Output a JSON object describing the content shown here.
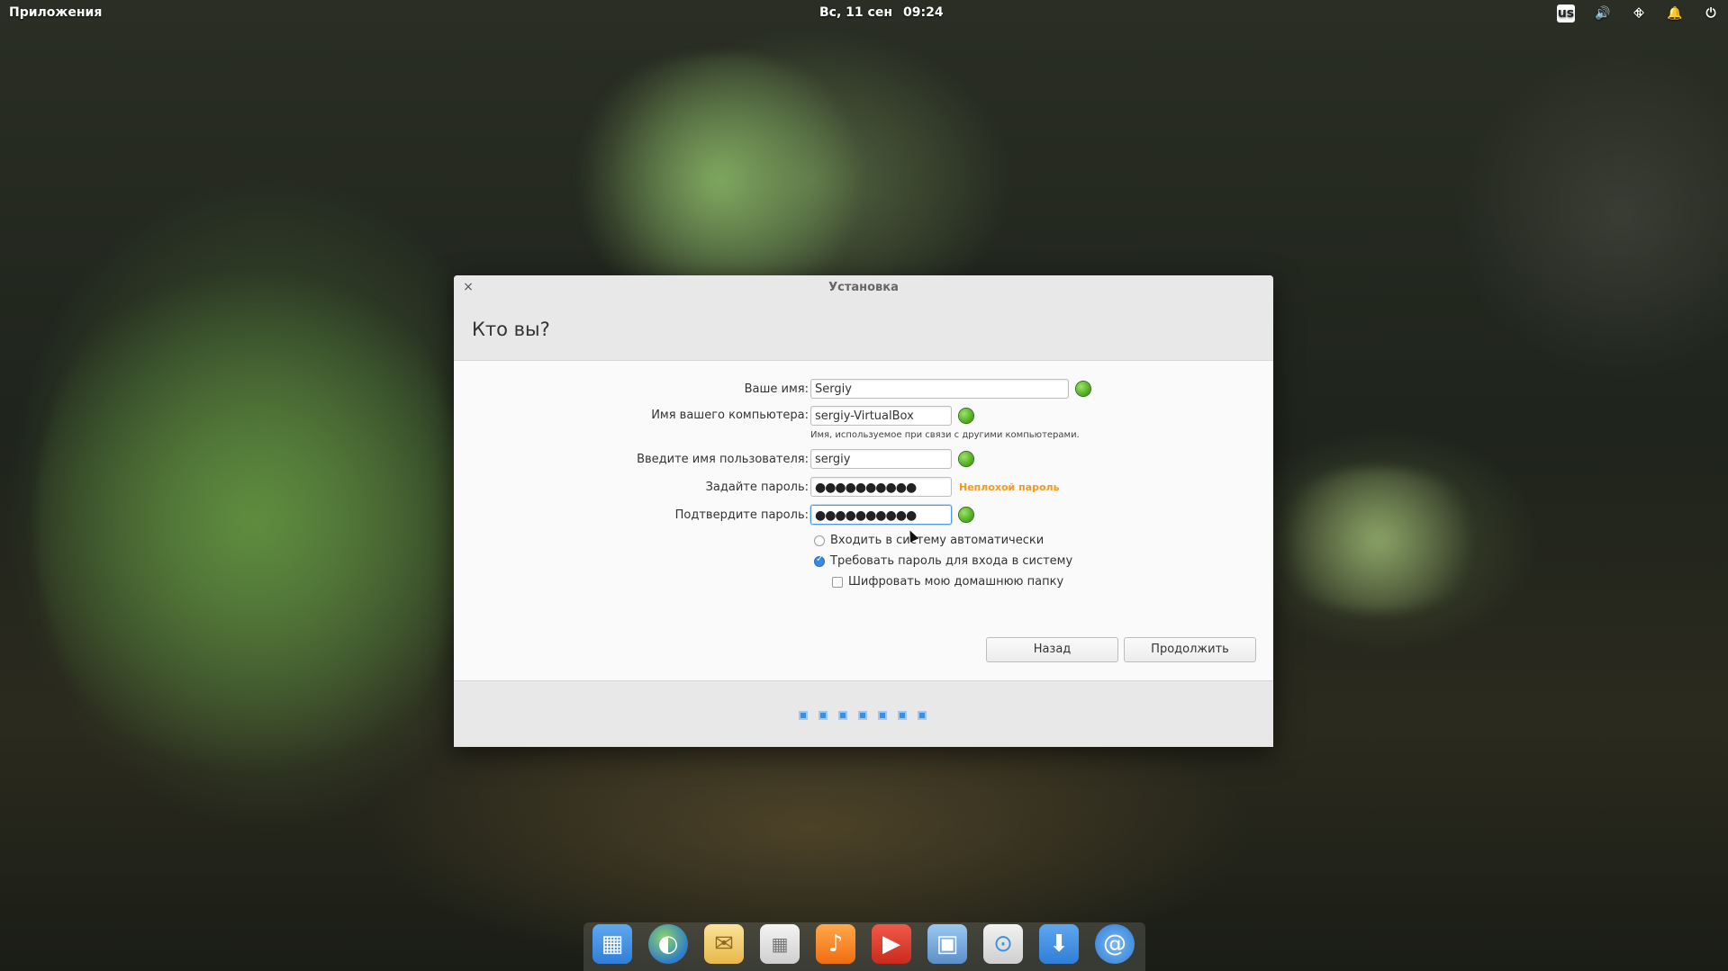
{
  "topbar": {
    "apps_label": "Приложения",
    "date": "Вс, 11 сен",
    "time": "09:24",
    "keyboard_layout": "us"
  },
  "window": {
    "title": "Установка",
    "heading": "Кто вы?"
  },
  "form": {
    "name_label": "Ваше имя:",
    "name_value": "Sergiy",
    "computer_label": "Имя вашего компьютера:",
    "computer_value": "sergiy-VirtualBox",
    "computer_hint": "Имя, используемое при связи с другими компьютерами.",
    "username_label": "Введите имя пользователя:",
    "username_value": "sergiy",
    "password_label": "Задайте пароль:",
    "password_value": "●●●●●●●●●●",
    "password_strength": "Неплохой пароль",
    "confirm_label": "Подтвердите пароль:",
    "confirm_value": "●●●●●●●●●●"
  },
  "options": {
    "auto_login": "Входить в систему автоматически",
    "require_password": "Требовать пароль для входа в систему",
    "encrypt_home": "Шифровать мою домашнюю папку"
  },
  "buttons": {
    "back": "Назад",
    "continue": "Продолжить"
  },
  "progress": {
    "total_steps": 7
  },
  "colors": {
    "accent": "#3689e6",
    "ok_green": "#4aa51a",
    "strength_orange": "#f39a1c"
  },
  "dock_items": [
    "multitasking-icon",
    "browser-icon",
    "mail-icon",
    "calendar-icon",
    "music-icon",
    "videos-icon",
    "photos-icon",
    "settings-icon",
    "appcenter-icon",
    "installer-icon"
  ]
}
